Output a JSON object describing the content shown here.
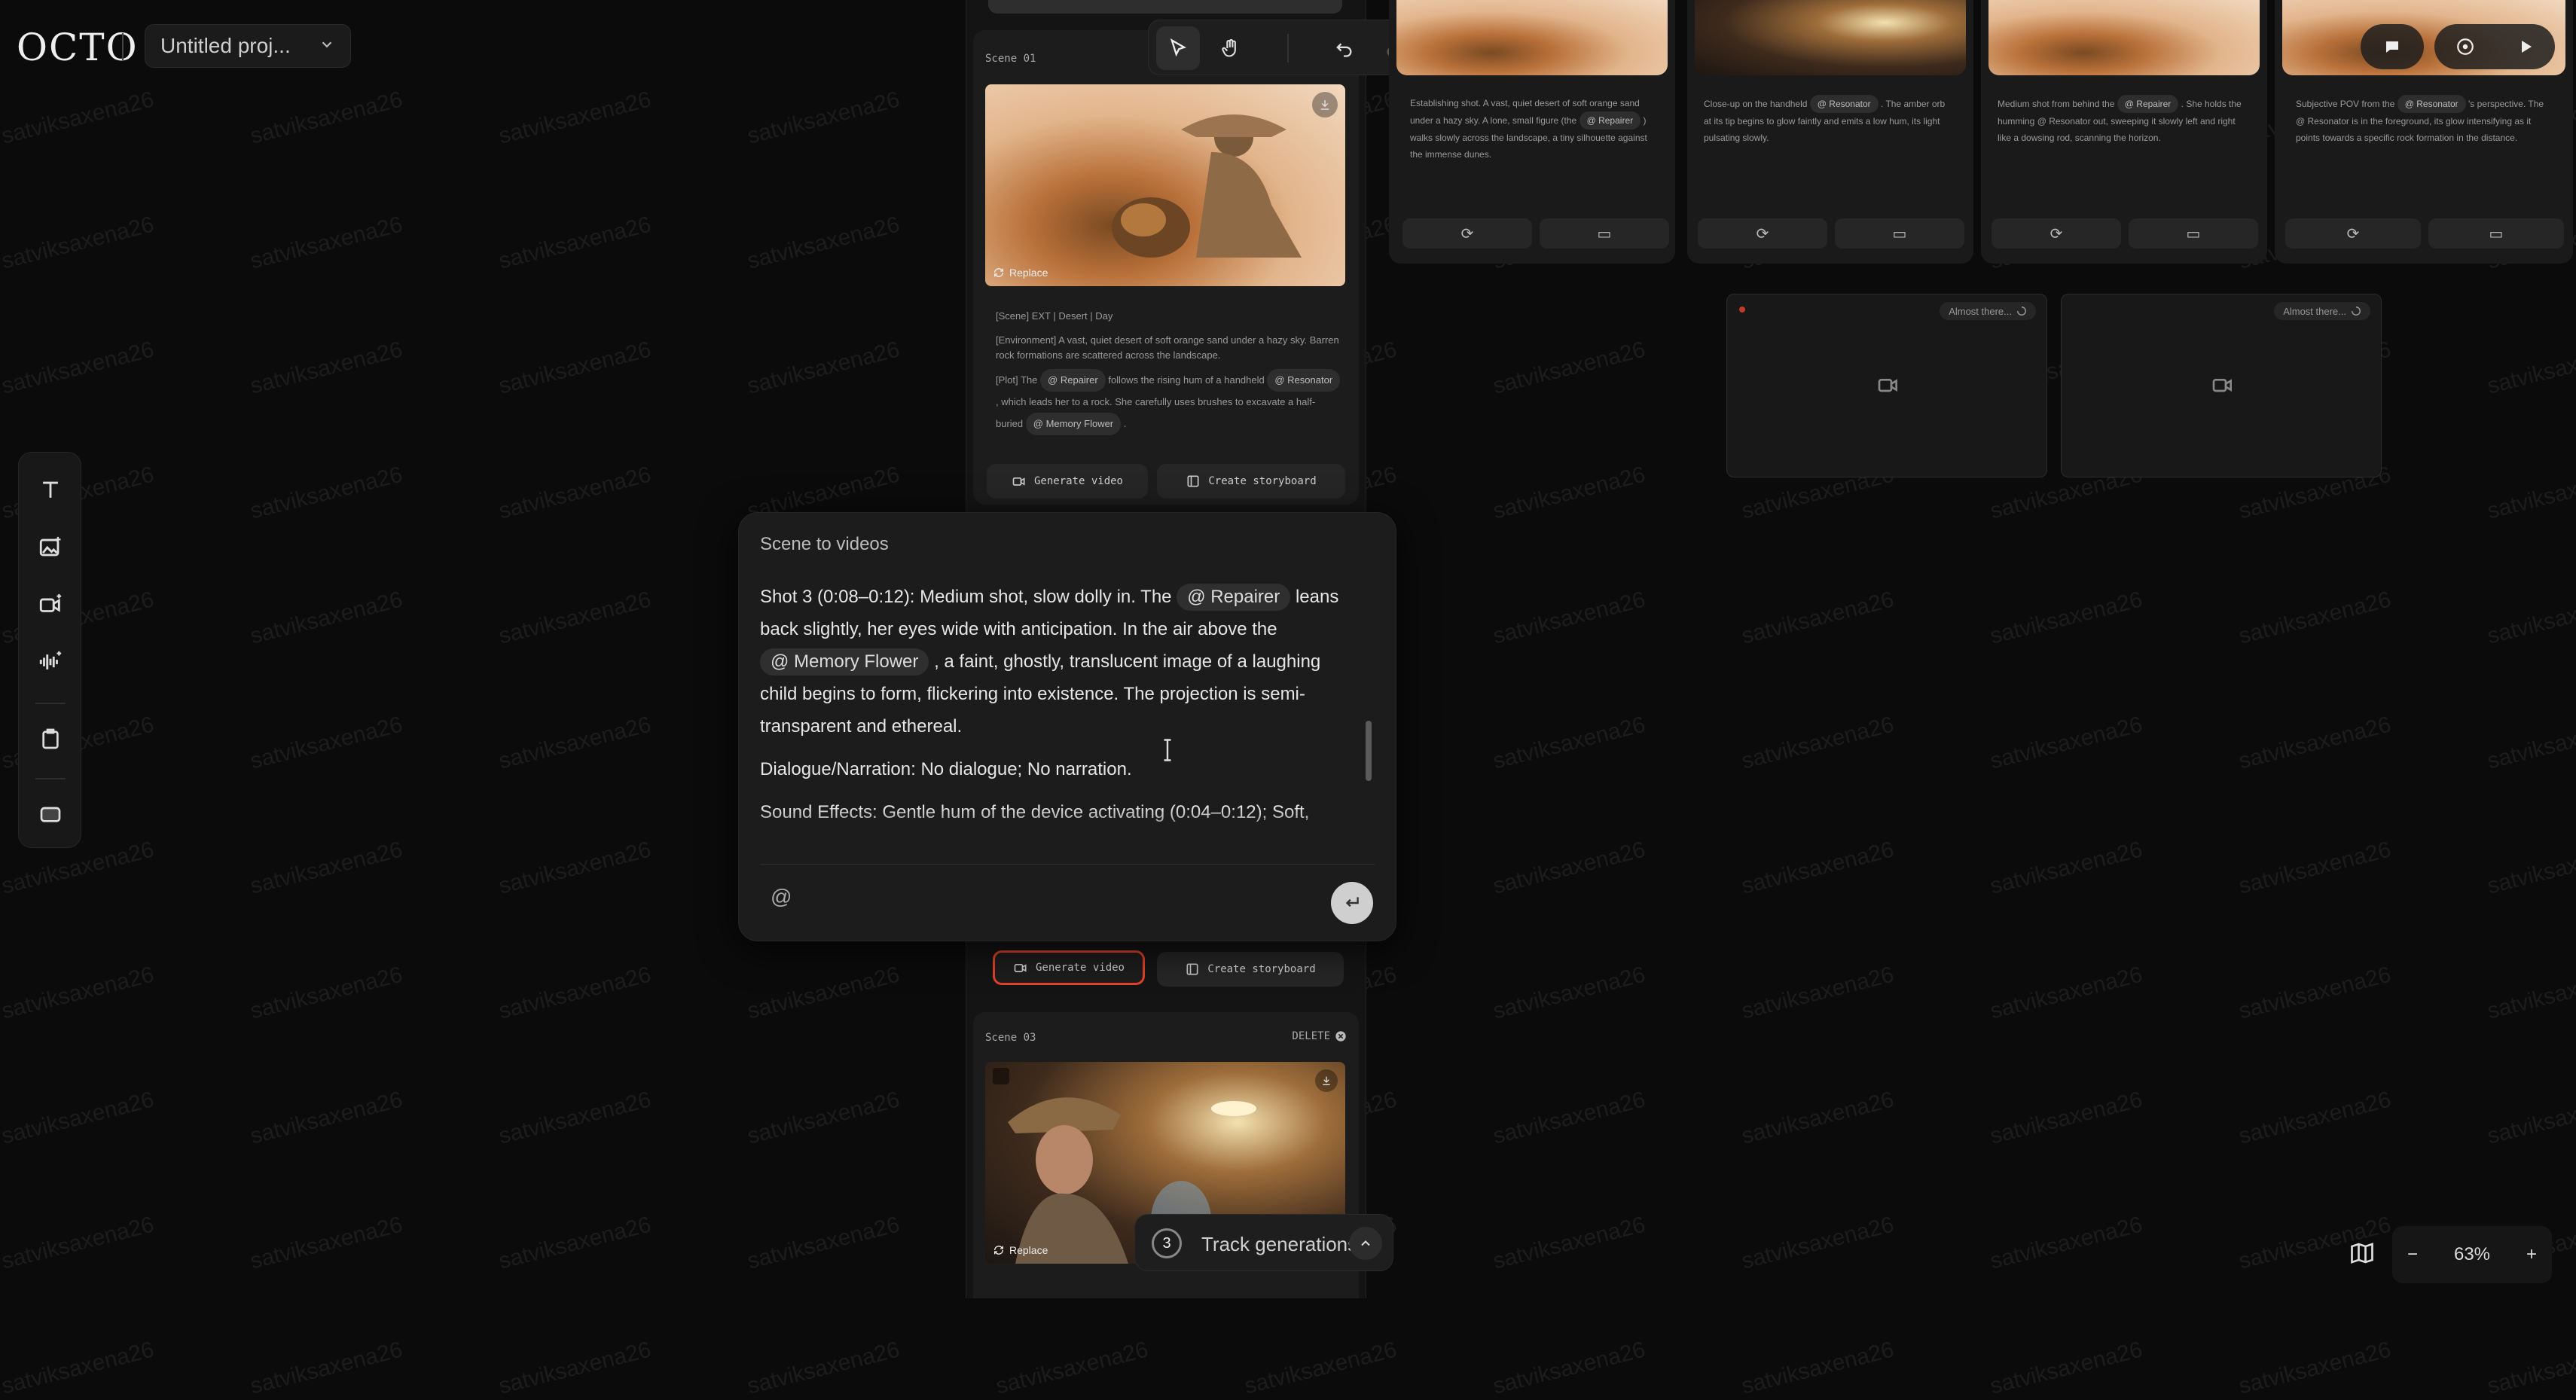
{
  "app": {
    "logo": "OCTO",
    "project_name": "Untitled proj..."
  },
  "watermark": "satviksaxena26",
  "left_toolbar": {
    "tools": [
      "text-tool-icon",
      "image-tool-icon",
      "video-tool-icon",
      "audio-tool-icon",
      "clipboard-icon",
      "frame-icon"
    ]
  },
  "scene1": {
    "label": "Scene 01",
    "replace": "Replace",
    "heading": "[Scene] EXT | Desert | Day",
    "environment": "[Environment] A vast, quiet desert of soft orange sand under a hazy sky. Barren rock formations are scattered across the landscape.",
    "plot_a": "[Plot] The",
    "plot_tag1": "@ Repairer",
    "plot_b": "follows the rising hum of a handheld",
    "plot_tag2": "@ Resonator",
    "plot_c": ", which leads her to a rock. She carefully uses brushes to excavate a half-buried",
    "plot_tag3": "@ Memory Flower",
    "plot_d": ".",
    "generate_video": "Generate video",
    "create_storyboard": "Create storyboard"
  },
  "scene2_actions": {
    "generate_video": "Generate video",
    "create_storyboard": "Create storyboard"
  },
  "scene3": {
    "label": "Scene 03",
    "delete": "DELETE",
    "replace": "Replace"
  },
  "dialog": {
    "title": "Scene to videos",
    "shot_a": "Shot 3 (0:08–0:12): Medium shot, slow dolly in. The",
    "tag_repairer": "@ Repairer",
    "shot_b": "leans back slightly, her eyes wide with anticipation. In the air above the",
    "tag_flower": "@ Memory Flower",
    "shot_c": ", a faint, ghostly, translucent image of a laughing child begins to form, flickering into existence. The projection is semi-transparent and ethereal.",
    "dialogue": "Dialogue/Narration: No dialogue; No narration.",
    "sound": "Sound Effects: Gentle hum of the device activating (0:04–0:12); Soft,",
    "input_placeholder": "@"
  },
  "shots": [
    {
      "text_a": "Establishing shot. A vast, quiet desert of soft orange sand under a hazy sky. A lone, small figure (the",
      "tag": "@ Repairer",
      "text_b": ") walks slowly across the landscape, a tiny silhouette against the immense dunes."
    },
    {
      "text_a": "Close-up on the handheld",
      "tag": "@ Resonator",
      "text_b": ". The amber orb at its tip begins to glow faintly and emits a low hum, its light pulsating slowly."
    },
    {
      "text_a": "Medium shot from behind the",
      "tag": "@ Repairer",
      "text_b": ". She holds the humming @ Resonator out, sweeping it slowly left and right like a dowsing rod, scanning the horizon."
    },
    {
      "text_a": "Subjective POV from the",
      "tag": "@ Resonator",
      "text_b": "'s perspective. The @ Resonator is in the foreground, its glow intensifying as it points towards a specific rock formation in the distance."
    }
  ],
  "pending": [
    {
      "status": "Almost there..."
    },
    {
      "status": "Almost there..."
    }
  ],
  "track": {
    "count": "3",
    "label": "Track generations"
  },
  "zoom": {
    "value": "63%"
  }
}
